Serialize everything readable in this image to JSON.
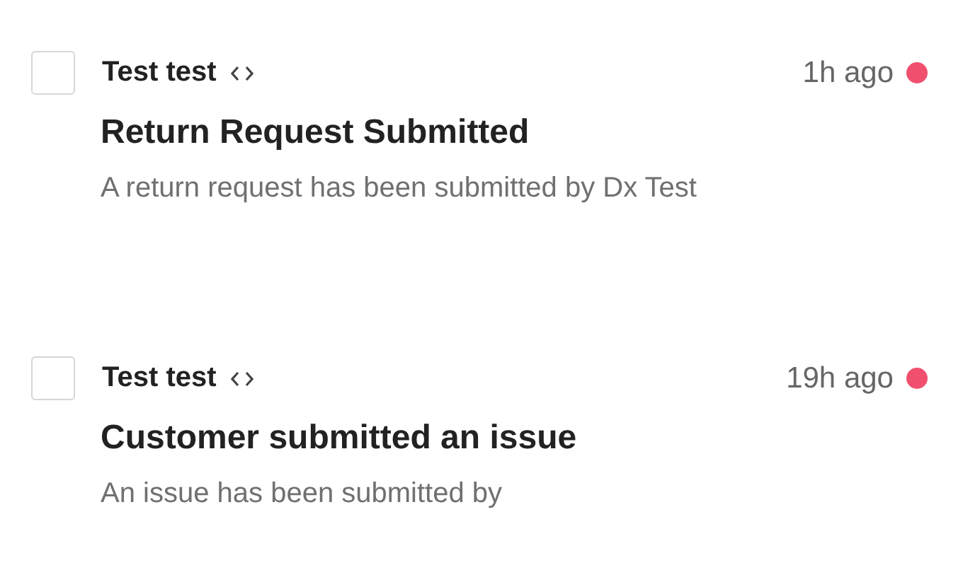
{
  "notifications": [
    {
      "checked": false,
      "sender": "Test test",
      "time": "1h ago",
      "unread": true,
      "title": "Return Request Submitted",
      "description": "A return request has been submitted by Dx Test"
    },
    {
      "checked": false,
      "sender": "Test test",
      "time": "19h ago",
      "unread": true,
      "title": "Customer submitted an issue",
      "description": "An issue has been submitted by"
    }
  ]
}
